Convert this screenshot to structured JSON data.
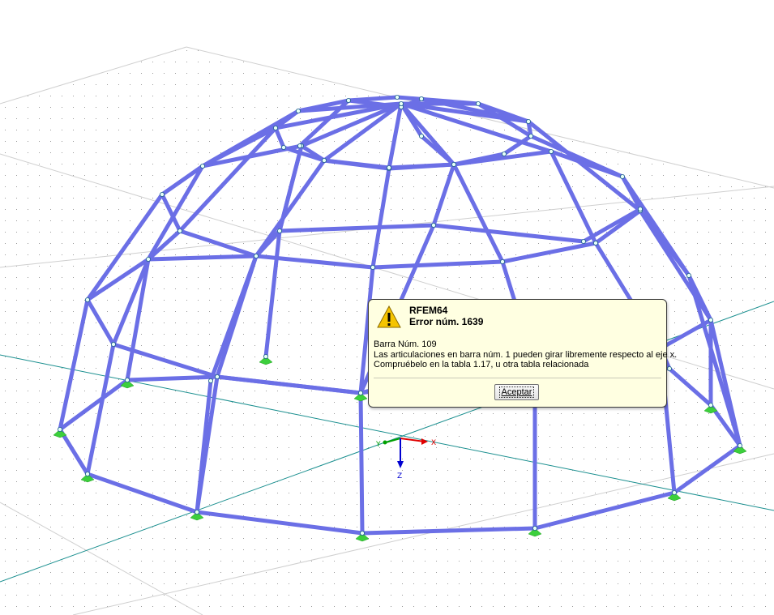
{
  "dialog": {
    "icon": "warning-icon",
    "app_name": "RFEM64",
    "error_label": "Error núm. 1639",
    "member_label": "Barra Núm. 109",
    "message_line1": "Las articulaciones en barra núm. 1 pueden girar libremente respecto al eje x.",
    "message_line2": "Compruébelo en la tabla 1.17, u otra tabla relacionada",
    "ok_button": "Aceptar",
    "background_color": "#ffffe1"
  },
  "axes": {
    "x_label": "X",
    "y_label": "Y",
    "z_label": "Z",
    "x_color": "#e00000",
    "y_color": "#00a000",
    "z_color": "#0000d0"
  },
  "model": {
    "member_color": "#6b6fe6",
    "support_color": "#3ccf3c",
    "node_color": "#e6fff6",
    "grid_line_color": "#1a8f8f"
  }
}
